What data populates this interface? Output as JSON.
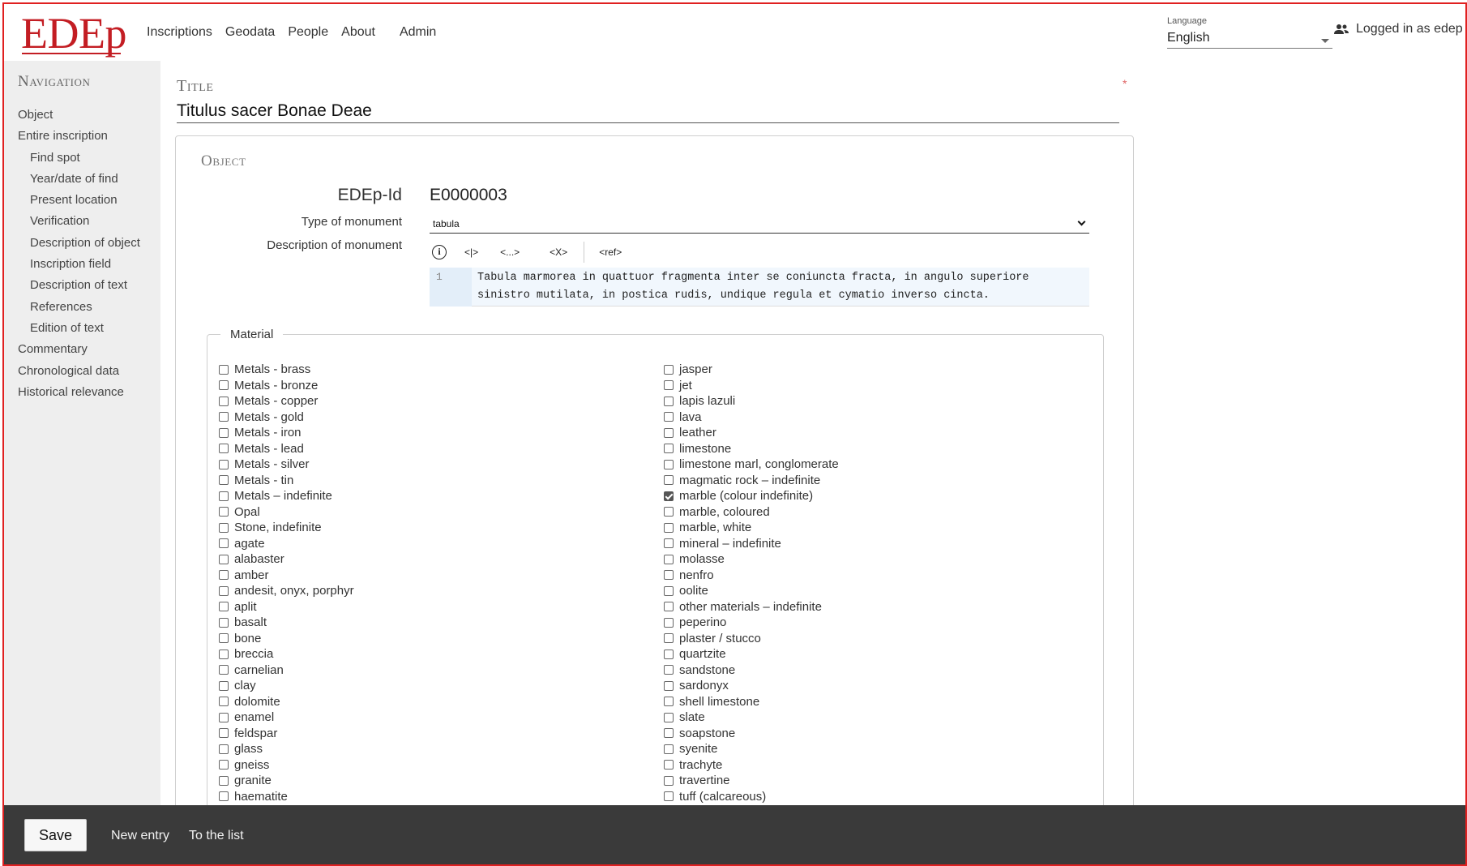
{
  "header": {
    "logo": "EDEp",
    "nav": [
      "Inscriptions",
      "Geodata",
      "People",
      "About",
      "Admin"
    ],
    "language_label": "Language",
    "language_value": "English",
    "login_text": "Logged in as edep"
  },
  "sidebar": {
    "title": "Navigation",
    "items": [
      {
        "label": "Object",
        "sub": false
      },
      {
        "label": "Entire inscription",
        "sub": false
      },
      {
        "label": "Find spot",
        "sub": true
      },
      {
        "label": "Year/date of find",
        "sub": true
      },
      {
        "label": "Present location",
        "sub": true
      },
      {
        "label": "Verification",
        "sub": true
      },
      {
        "label": "Description of object",
        "sub": true
      },
      {
        "label": "Inscription field",
        "sub": true
      },
      {
        "label": "Description of text",
        "sub": true
      },
      {
        "label": "References",
        "sub": true
      },
      {
        "label": "Edition of text",
        "sub": true
      },
      {
        "label": "Commentary",
        "sub": false
      },
      {
        "label": "Chronological data",
        "sub": false
      },
      {
        "label": "Historical relevance",
        "sub": false
      }
    ]
  },
  "title_field": {
    "label": "Title",
    "required": "*",
    "value": "Titulus sacer Bonae Deae"
  },
  "object": {
    "card_title": "Object",
    "edep_id_label": "EDEp-Id",
    "edep_id_value": "E0000003",
    "type_label": "Type of monument",
    "type_value": "tabula",
    "desc_label": "Description of monument",
    "toolbar": {
      "info": "i",
      "b1": "<|>",
      "b2": "<...>",
      "b3": "<X>",
      "b4": "<ref>"
    },
    "editor_line_no": "1",
    "editor_text": "Tabula marmorea in quattuor fragmenta inter se coniuncta fracta, in angulo superiore sinistro mutilata, in postica rudis, undique regula et cymatio inverso cincta."
  },
  "material": {
    "legend": "Material",
    "col1": [
      {
        "label": "Metals - brass",
        "checked": false
      },
      {
        "label": "Metals - bronze",
        "checked": false
      },
      {
        "label": "Metals - copper",
        "checked": false
      },
      {
        "label": "Metals - gold",
        "checked": false
      },
      {
        "label": "Metals - iron",
        "checked": false
      },
      {
        "label": "Metals - lead",
        "checked": false
      },
      {
        "label": "Metals - silver",
        "checked": false
      },
      {
        "label": "Metals - tin",
        "checked": false
      },
      {
        "label": "Metals – indefinite",
        "checked": false
      },
      {
        "label": "Opal",
        "checked": false
      },
      {
        "label": "Stone, indefinite",
        "checked": false
      },
      {
        "label": "agate",
        "checked": false
      },
      {
        "label": "alabaster",
        "checked": false
      },
      {
        "label": "amber",
        "checked": false
      },
      {
        "label": "andesit, onyx, porphyr",
        "checked": false
      },
      {
        "label": "aplit",
        "checked": false
      },
      {
        "label": "basalt",
        "checked": false
      },
      {
        "label": "bone",
        "checked": false
      },
      {
        "label": "breccia",
        "checked": false
      },
      {
        "label": "carnelian",
        "checked": false
      },
      {
        "label": "clay",
        "checked": false
      },
      {
        "label": "dolomite",
        "checked": false
      },
      {
        "label": "enamel",
        "checked": false
      },
      {
        "label": "feldspar",
        "checked": false
      },
      {
        "label": "glass",
        "checked": false
      },
      {
        "label": "gneiss",
        "checked": false
      },
      {
        "label": "granite",
        "checked": false
      },
      {
        "label": "haematite",
        "checked": false
      }
    ],
    "col2": [
      {
        "label": "jasper",
        "checked": false
      },
      {
        "label": "jet",
        "checked": false
      },
      {
        "label": "lapis lazuli",
        "checked": false
      },
      {
        "label": "lava",
        "checked": false
      },
      {
        "label": "leather",
        "checked": false
      },
      {
        "label": "limestone",
        "checked": false
      },
      {
        "label": "limestone marl, conglomerate",
        "checked": false
      },
      {
        "label": "magmatic rock – indefinite",
        "checked": false
      },
      {
        "label": "marble (colour indefinite)",
        "checked": true
      },
      {
        "label": "marble, coloured",
        "checked": false
      },
      {
        "label": "marble, white",
        "checked": false
      },
      {
        "label": "mineral – indefinite",
        "checked": false
      },
      {
        "label": "molasse",
        "checked": false
      },
      {
        "label": "nenfro",
        "checked": false
      },
      {
        "label": "oolite",
        "checked": false
      },
      {
        "label": "other materials – indefinite",
        "checked": false
      },
      {
        "label": "peperino",
        "checked": false
      },
      {
        "label": "plaster / stucco",
        "checked": false
      },
      {
        "label": "quartzite",
        "checked": false
      },
      {
        "label": "sandstone",
        "checked": false
      },
      {
        "label": "sardonyx",
        "checked": false
      },
      {
        "label": "shell limestone",
        "checked": false
      },
      {
        "label": "slate",
        "checked": false
      },
      {
        "label": "soapstone",
        "checked": false
      },
      {
        "label": "syenite",
        "checked": false
      },
      {
        "label": "trachyte",
        "checked": false
      },
      {
        "label": "travertine",
        "checked": false
      },
      {
        "label": "tuff (calcareous)",
        "checked": false
      }
    ]
  },
  "footer": {
    "save": "Save",
    "new_entry": "New entry",
    "to_list": "To the list"
  },
  "colors": {
    "brand": "#c31d23",
    "footer_bg": "#3a3a3a",
    "sidebar_bg": "#eeeeee"
  }
}
